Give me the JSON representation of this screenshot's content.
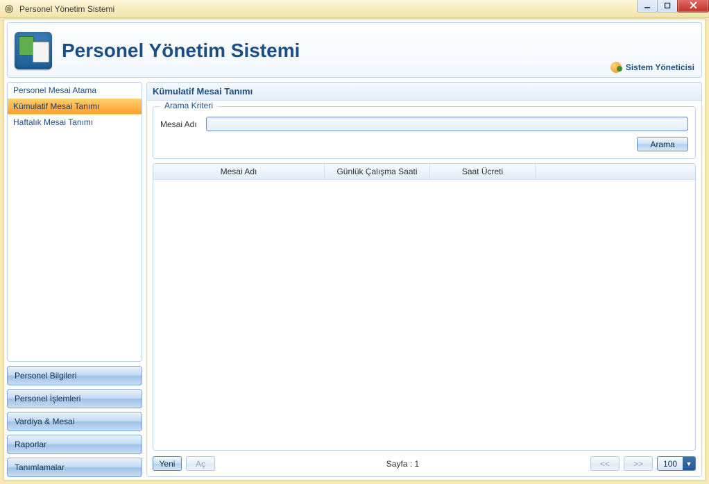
{
  "window": {
    "title": "Personel Yönetim Sistemi"
  },
  "banner": {
    "title": "Personel Yönetim Sistemi",
    "user_label": "Sistem Yöneticisi"
  },
  "sidebar": {
    "items": [
      {
        "label": "Personel Mesai Atama",
        "active": false
      },
      {
        "label": "Kümulatif Mesai Tanımı",
        "active": true
      },
      {
        "label": "Haftalık Mesai Tanımı",
        "active": false
      }
    ],
    "categories": [
      {
        "label": "Personel Bilgileri"
      },
      {
        "label": "Personel İşlemleri"
      },
      {
        "label": "Vardiya & Mesai"
      },
      {
        "label": "Raporlar"
      },
      {
        "label": "Tanımlamalar"
      }
    ]
  },
  "main": {
    "title": "Kümulatif Mesai Tanımı",
    "search": {
      "legend": "Arama Kriteri",
      "field_label": "Mesai Adı",
      "value": "",
      "button": "Arama"
    },
    "grid": {
      "columns": [
        "Mesai Adı",
        "Günlük Çalışma Saati",
        "Saat Ücreti"
      ],
      "rows": []
    },
    "footer": {
      "new": "Yeni",
      "open": "Aç",
      "page_label": "Sayfa : 1",
      "prev": "<<",
      "next": ">>",
      "page_size": "100"
    }
  }
}
